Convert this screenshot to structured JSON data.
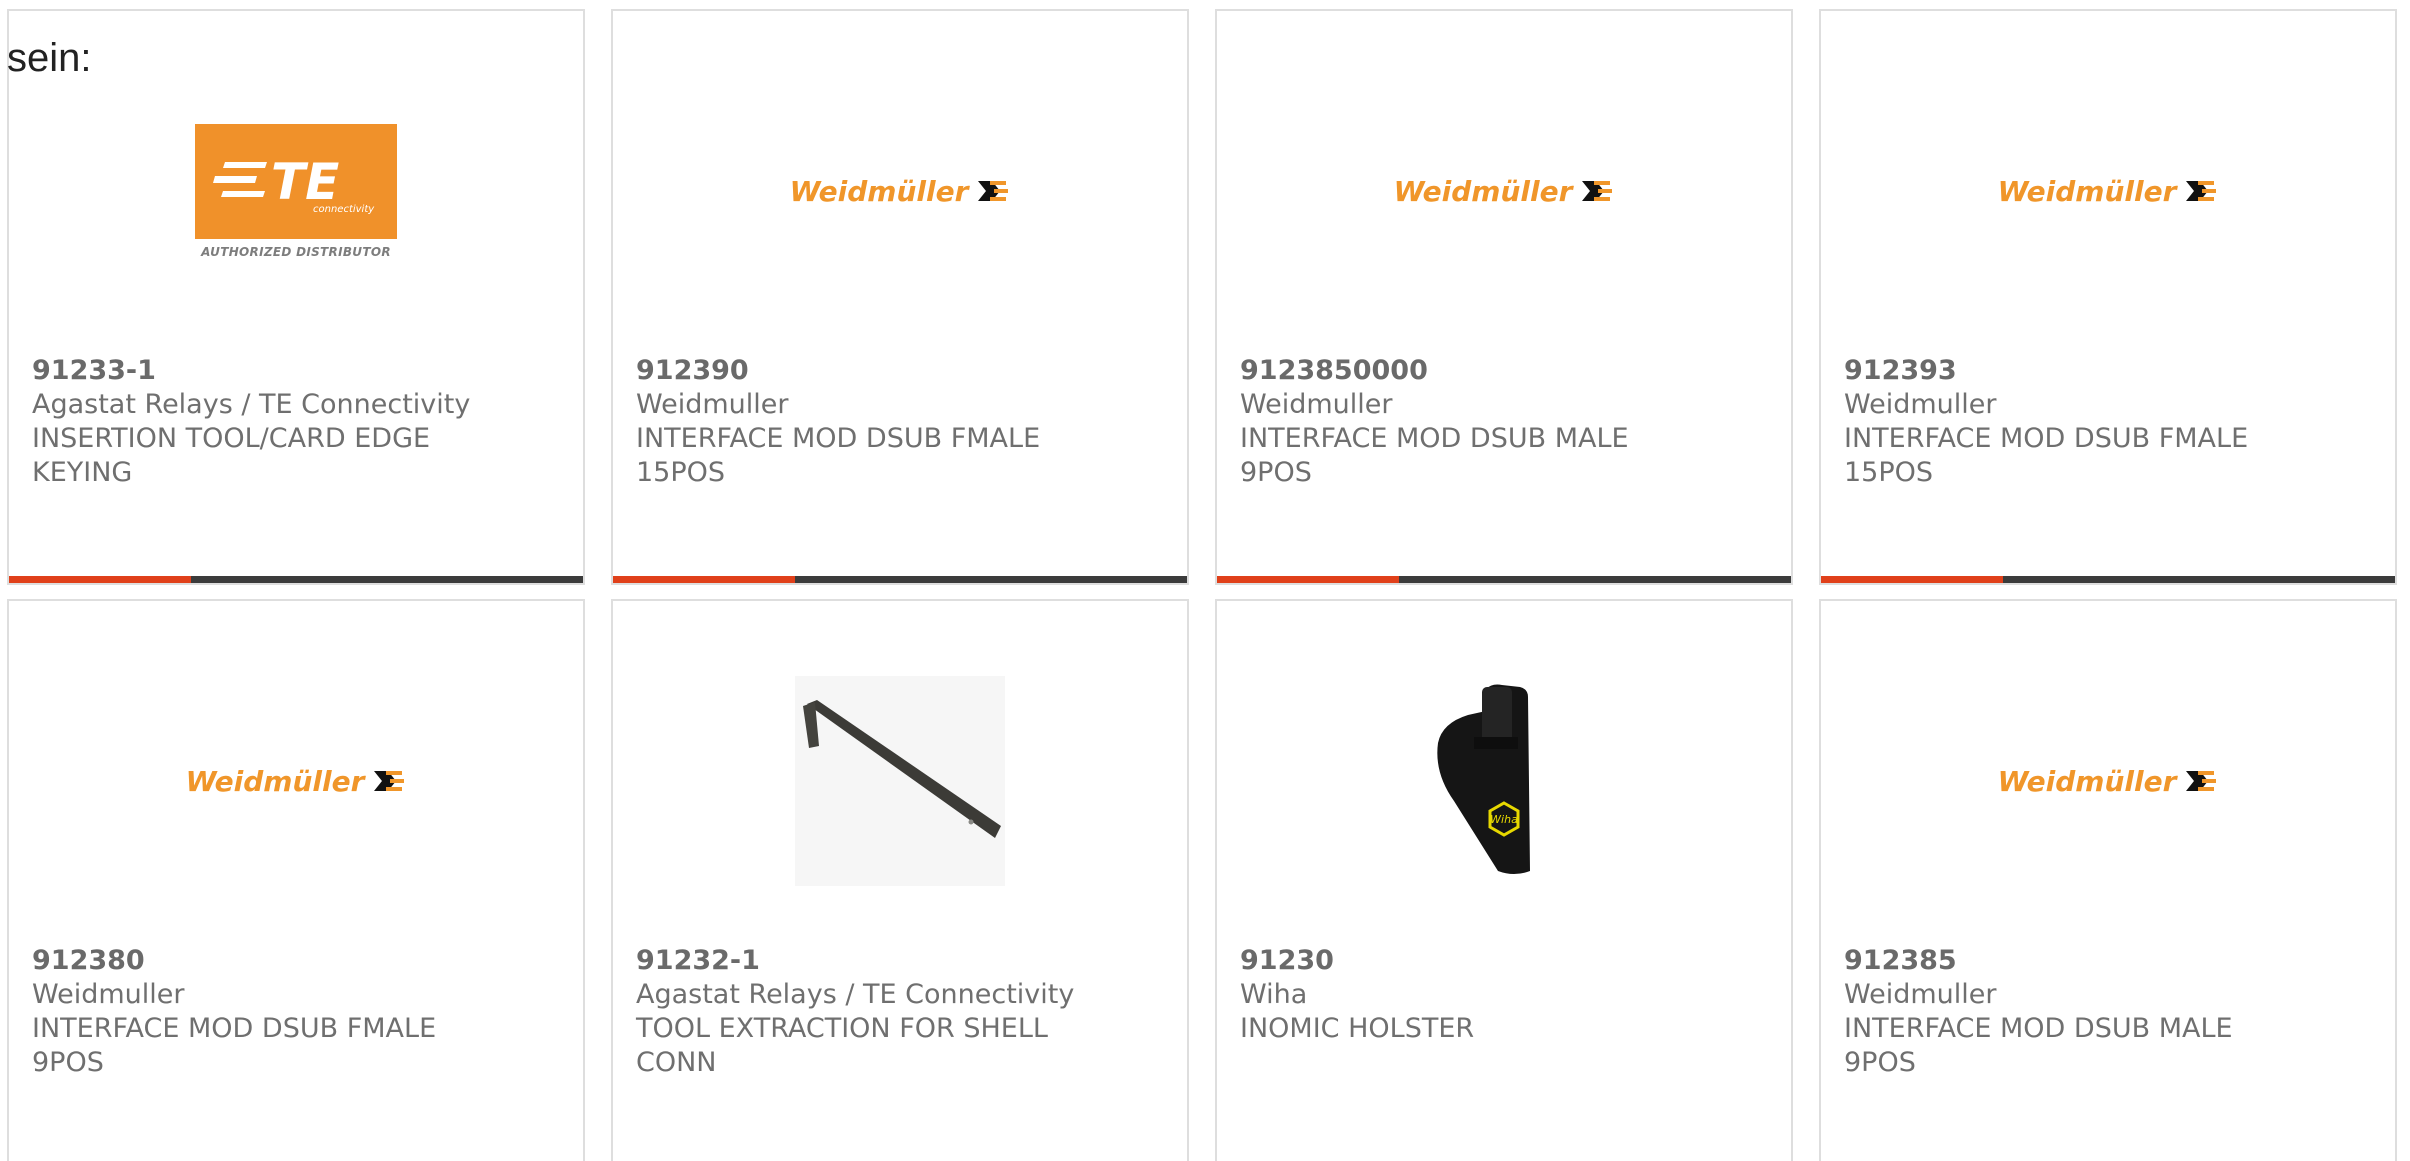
{
  "intro_text": "sein:",
  "products": [
    {
      "part_number": "91233-1",
      "manufacturer": "Agastat Relays / TE Connectivity",
      "desc_line1": "INSERTION TOOL/CARD EDGE",
      "desc_line2": "KEYING",
      "image": "te-connectivity-logo",
      "has_progress_bar": true
    },
    {
      "part_number": "912390",
      "manufacturer": "Weidmuller",
      "desc_line1": "INTERFACE MOD DSUB FMALE",
      "desc_line2": "15POS",
      "image": "weidmuller-logo",
      "has_progress_bar": true
    },
    {
      "part_number": "9123850000",
      "manufacturer": "Weidmuller",
      "desc_line1": "INTERFACE MOD DSUB MALE",
      "desc_line2": "9POS",
      "image": "weidmuller-logo",
      "has_progress_bar": true
    },
    {
      "part_number": "912393",
      "manufacturer": "Weidmuller",
      "desc_line1": "INTERFACE MOD DSUB FMALE",
      "desc_line2": "15POS",
      "image": "weidmuller-logo",
      "has_progress_bar": true
    },
    {
      "part_number": "912380",
      "manufacturer": "Weidmuller",
      "desc_line1": "INTERFACE MOD DSUB FMALE",
      "desc_line2": "9POS",
      "image": "weidmuller-logo",
      "has_progress_bar": false
    },
    {
      "part_number": "91232-1",
      "manufacturer": "Agastat Relays / TE Connectivity",
      "desc_line1": "TOOL EXTRACTION FOR SHELL",
      "desc_line2": "CONN",
      "image": "extraction-tool-photo",
      "has_progress_bar": false
    },
    {
      "part_number": "91230",
      "manufacturer": "Wiha",
      "desc_line1": "INOMIC HOLSTER",
      "desc_line2": "",
      "image": "holster-photo",
      "has_progress_bar": false
    },
    {
      "part_number": "912385",
      "manufacturer": "Weidmuller",
      "desc_line1": "INTERFACE MOD DSUB MALE",
      "desc_line2": "9POS",
      "image": "weidmuller-logo",
      "has_progress_bar": false
    }
  ],
  "logos": {
    "weidmuller_text": "Weidmüller",
    "te_text": "TE",
    "te_sub_text": "connectivity",
    "te_distributor_text": "AUTHORIZED DISTRIBUTOR",
    "wiha_text": "Wiha"
  },
  "colors": {
    "accent_bar": "#e0401a",
    "dark_bar": "#3b3b3b",
    "weidmuller_orange": "#f0962a",
    "te_orange": "#f0912a",
    "card_border": "#dedede",
    "text_gray": "#6f6f6f"
  }
}
